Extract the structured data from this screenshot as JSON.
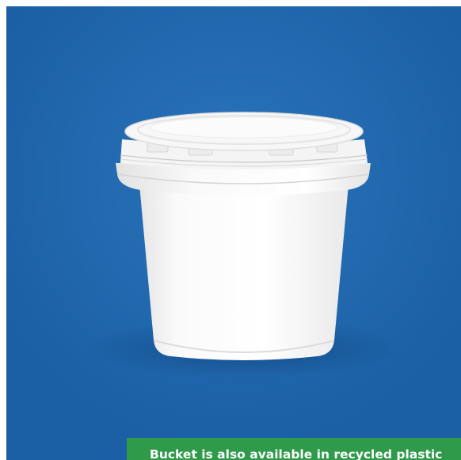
{
  "product": {
    "image_name": "white-plastic-bucket-with-lid",
    "background_color": "#1d63a8",
    "bucket_color": "#f7f7f7"
  },
  "banner": {
    "text": "Bucket is also available in recycled plastic",
    "color": "#2e9a4a"
  }
}
